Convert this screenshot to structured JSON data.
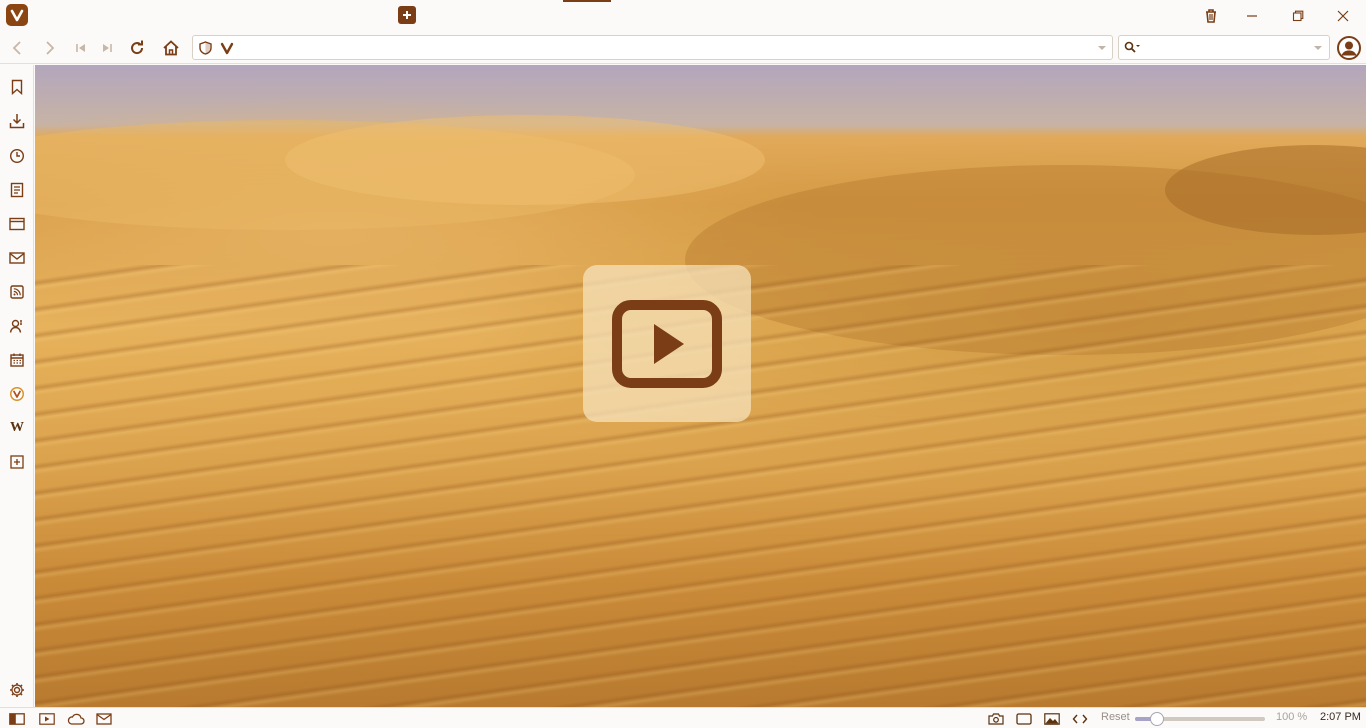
{
  "browser": {
    "accent": "#7a3d16",
    "logo_icon": "vivaldi-logo-icon"
  },
  "titlebar": {
    "newtab_icon": "plus-icon",
    "window_controls": [
      "trash-icon",
      "minimize-icon",
      "restore-icon",
      "close-icon"
    ]
  },
  "navbar": {
    "buttons": [
      "back-icon",
      "forward-icon",
      "rewind-icon",
      "fast-forward-icon",
      "reload-icon",
      "home-icon"
    ],
    "address": {
      "value": "",
      "placeholder": ""
    },
    "search": {
      "value": "",
      "placeholder": ""
    }
  },
  "sidepanel": {
    "items": [
      "bookmark-icon",
      "download-icon",
      "history-icon",
      "notes-icon",
      "window-icon",
      "mail-icon",
      "feed-icon",
      "contacts-icon",
      "calendar-icon",
      "vivaldi-icon",
      "wikipedia-icon",
      "add-panel-icon"
    ],
    "wikipedia_glyph": "W",
    "settings": "gear-icon"
  },
  "content": {
    "background": "desert sand dunes",
    "overlay_icon": "play-video-icon"
  },
  "statusbar": {
    "left_buttons": [
      "panel-toggle-icon",
      "media-icon",
      "cloud-sync-icon",
      "mail-status-icon"
    ],
    "right_buttons": [
      "camera-icon",
      "tiling-icon",
      "image-icon",
      "code-icon"
    ],
    "reset_label": "Reset",
    "zoom": 100,
    "zoom_label": "100 %",
    "clock": "2:07 PM"
  }
}
